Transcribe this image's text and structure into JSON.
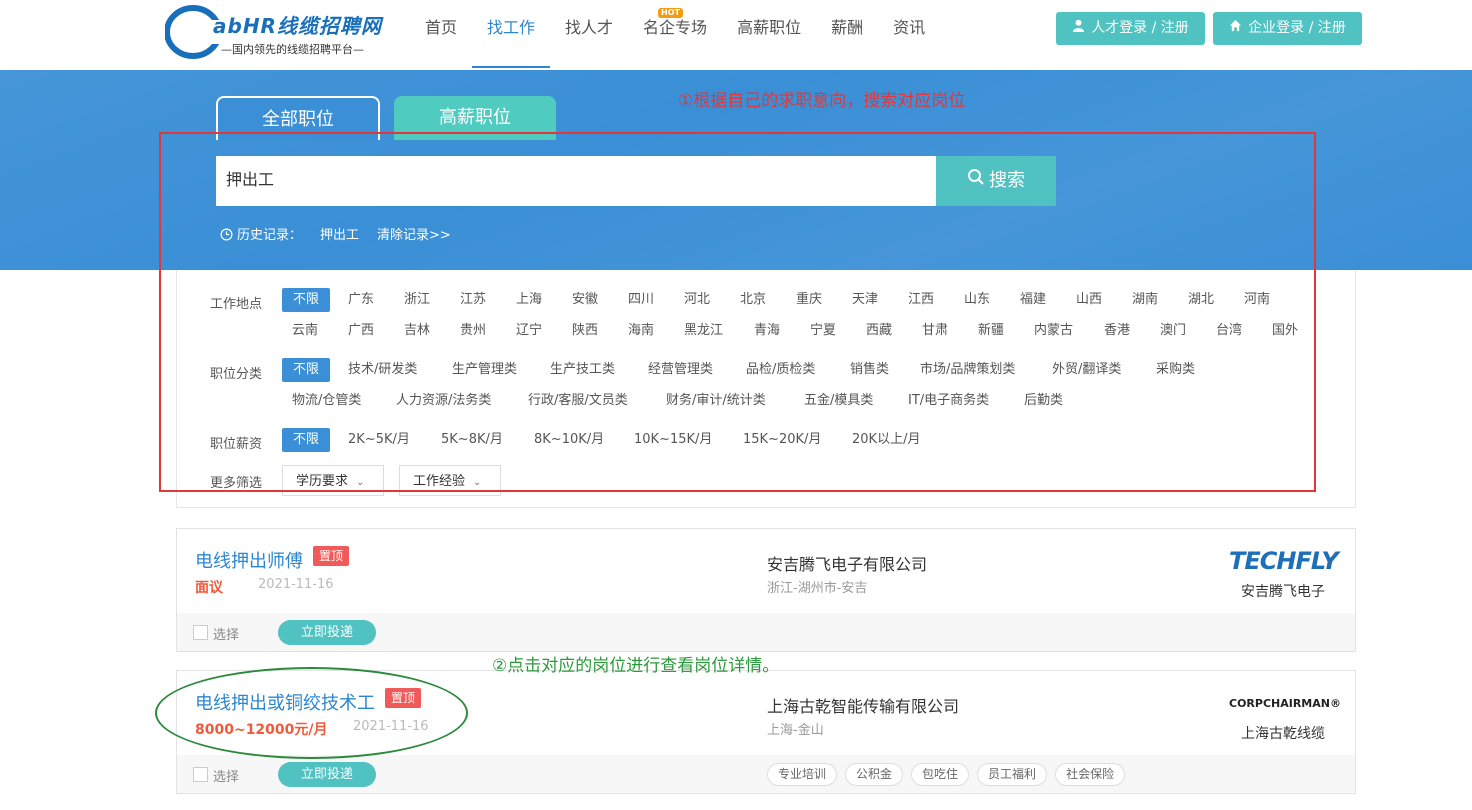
{
  "header": {
    "logo_title": "abHR线缆招聘网",
    "logo_slogan": "—国内领先的线缆招聘平台—",
    "nav": [
      {
        "label": "首页"
      },
      {
        "label": "找工作"
      },
      {
        "label": "找人才"
      },
      {
        "label": "名企专场",
        "badge": "HOT"
      },
      {
        "label": "高薪职位"
      },
      {
        "label": "薪酬"
      },
      {
        "label": "资讯"
      }
    ],
    "talent_login": "人才登录 / 注册",
    "company_login": "企业登录 / 注册"
  },
  "search": {
    "tab_all": "全部职位",
    "tab_high": "高薪职位",
    "query": "押出工",
    "button": "搜索",
    "history_label": "历史记录：",
    "history_item": "押出工",
    "clear_history": "清除记录>>"
  },
  "filters": {
    "location_label": "工作地点",
    "location_row1": [
      "不限",
      "广东",
      "浙江",
      "江苏",
      "上海",
      "安徽",
      "四川",
      "河北",
      "北京",
      "重庆",
      "天津",
      "江西",
      "山东",
      "福建",
      "山西",
      "湖南",
      "湖北",
      "河南"
    ],
    "location_row2": [
      "云南",
      "广西",
      "吉林",
      "贵州",
      "辽宁",
      "陕西",
      "海南",
      "黑龙江",
      "青海",
      "宁夏",
      "西藏",
      "甘肃",
      "新疆",
      "内蒙古",
      "香港",
      "澳门",
      "台湾",
      "国外"
    ],
    "category_label": "职位分类",
    "category_row1": [
      "不限",
      "技术/研发类",
      "生产管理类",
      "生产技工类",
      "经营管理类",
      "品检/质检类",
      "销售类",
      "市场/品牌策划类",
      "外贸/翻译类",
      "采购类"
    ],
    "category_row2": [
      "物流/仓管类",
      "人力资源/法务类",
      "行政/客服/文员类",
      "财务/审计/统计类",
      "五金/模具类",
      "IT/电子商务类",
      "后勤类"
    ],
    "salary_label": "职位薪资",
    "salary_options": [
      "不限",
      "2K~5K/月",
      "5K~8K/月",
      "8K~10K/月",
      "10K~15K/月",
      "15K~20K/月",
      "20K以上/月"
    ],
    "more_label": "更多筛选",
    "education": "学历要求",
    "experience": "工作经验"
  },
  "annotations": {
    "step1": "①根据自己的求职意向，搜索对应岗位",
    "step2": "②点击对应的岗位进行查看岗位详情。"
  },
  "jobs": [
    {
      "title": "电线押出师傅",
      "pin": "置顶",
      "salary": "面议",
      "date": "2021-11-16",
      "company": "安吉腾飞电子有限公司",
      "location": "浙江-湖州市-安吉",
      "brand": "TECHFLY",
      "brand_name": "安吉腾飞电子",
      "select": "选择",
      "apply": "立即投递",
      "tags": []
    },
    {
      "title": "电线押出或铜绞技术工",
      "pin": "置顶",
      "salary": "8000~12000元/月",
      "date": "2021-11-16",
      "company": "上海古乾智能传输有限公司",
      "location": "上海-金山",
      "brand": "CORPCHAIRMAN®",
      "brand_name": "上海古乾线缆",
      "select": "选择",
      "apply": "立即投递",
      "tags": [
        "专业培训",
        "公积金",
        "包吃住",
        "员工福利",
        "社会保险"
      ]
    }
  ],
  "colors": {
    "primary_blue": "#3a8fd6",
    "teal": "#4fc2c1",
    "annotation_red": "#e0383a",
    "annotation_green": "#2b8a3b",
    "salary_orange": "#f05a3a"
  }
}
